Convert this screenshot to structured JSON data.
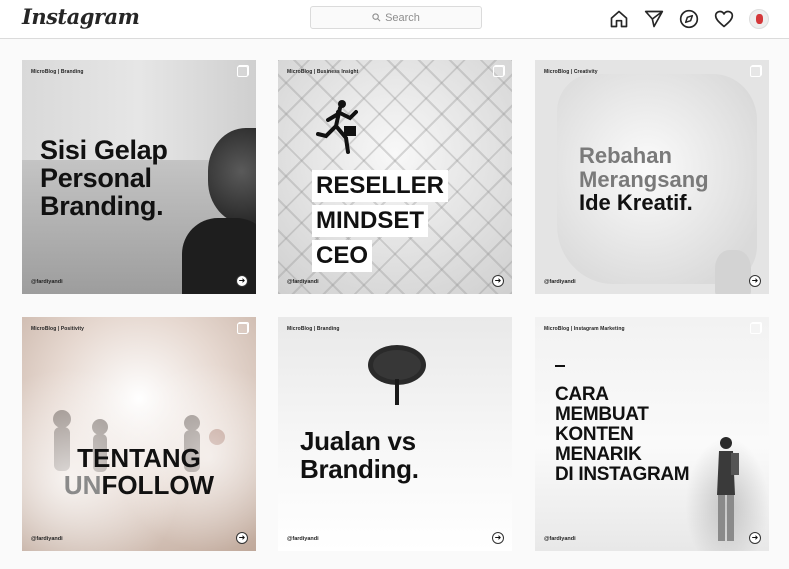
{
  "header": {
    "logo": "Instagram",
    "search_placeholder": "Search",
    "icons": [
      "home-icon",
      "direct-icon",
      "explore-icon",
      "activity-heart-icon",
      "profile-avatar"
    ]
  },
  "posts": [
    {
      "series": "MicroBlog | Branding",
      "title_lines": [
        "Sisi Gelap",
        "Personal",
        "Branding."
      ],
      "handle": "@fardiyandi"
    },
    {
      "series": "MicroBlog | Business Insight",
      "title_lines": [
        "RESELLER",
        "MINDSET",
        "CEO"
      ],
      "handle": "@fardiyandi"
    },
    {
      "series": "MicroBlog | Creativity",
      "title_lines": [
        "Rebahan",
        "Merangsang",
        "Ide Kreatif."
      ],
      "handle": "@fardiyandi"
    },
    {
      "series": "MicroBlog | Positivity",
      "title_line1": "TENTANG",
      "title_line2_un": "UN",
      "title_line2_rest": "FOLLOW",
      "handle": "@fardiyandi"
    },
    {
      "series": "MicroBlog | Branding",
      "title_lines": [
        "Jualan vs",
        "Branding."
      ],
      "handle": "@fardiyandi"
    },
    {
      "series": "MicroBlog | Instagram Marketing",
      "title_lines": [
        "CARA",
        "MEMBUAT",
        "KONTEN",
        "MENARIK",
        "DI INSTAGRAM"
      ],
      "handle": "@fardiyandi"
    }
  ]
}
